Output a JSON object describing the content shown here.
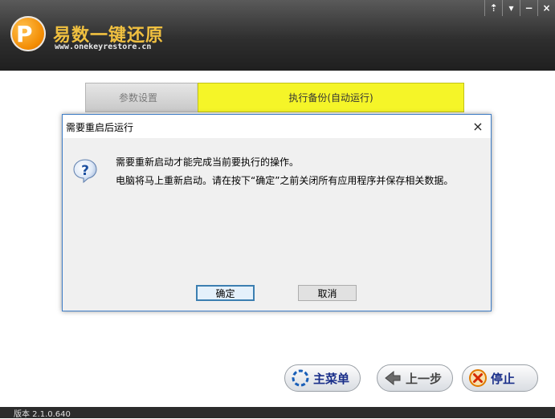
{
  "header": {
    "logo_letter": "P",
    "title": "易数一键还原",
    "url": "www.onekeyrestore.cn",
    "window_controls": [
      "⇡",
      "▾",
      "−",
      "×"
    ]
  },
  "steps": {
    "step1": "参数设置",
    "step2": "执行备份(自动运行)"
  },
  "dialog": {
    "title": "需要重启后运行",
    "close": "×",
    "icon": "question-icon",
    "message_line1": "需要重新启动才能完成当前要执行的操作。",
    "message_line2": "电脑将马上重新启动。请在按下“确定”之前关闭所有应用程序并保存相关数据。",
    "ok_label": "确定",
    "cancel_label": "取消"
  },
  "bottom": {
    "menu_label": "主菜单",
    "prev_label": "上一步",
    "stop_label": "停止"
  },
  "footer": {
    "version": "版本 2.1.0.640"
  },
  "colors": {
    "active_step": "#f5f528",
    "header_bg": "#2f2f2f",
    "title_gold": "#f0c040"
  }
}
